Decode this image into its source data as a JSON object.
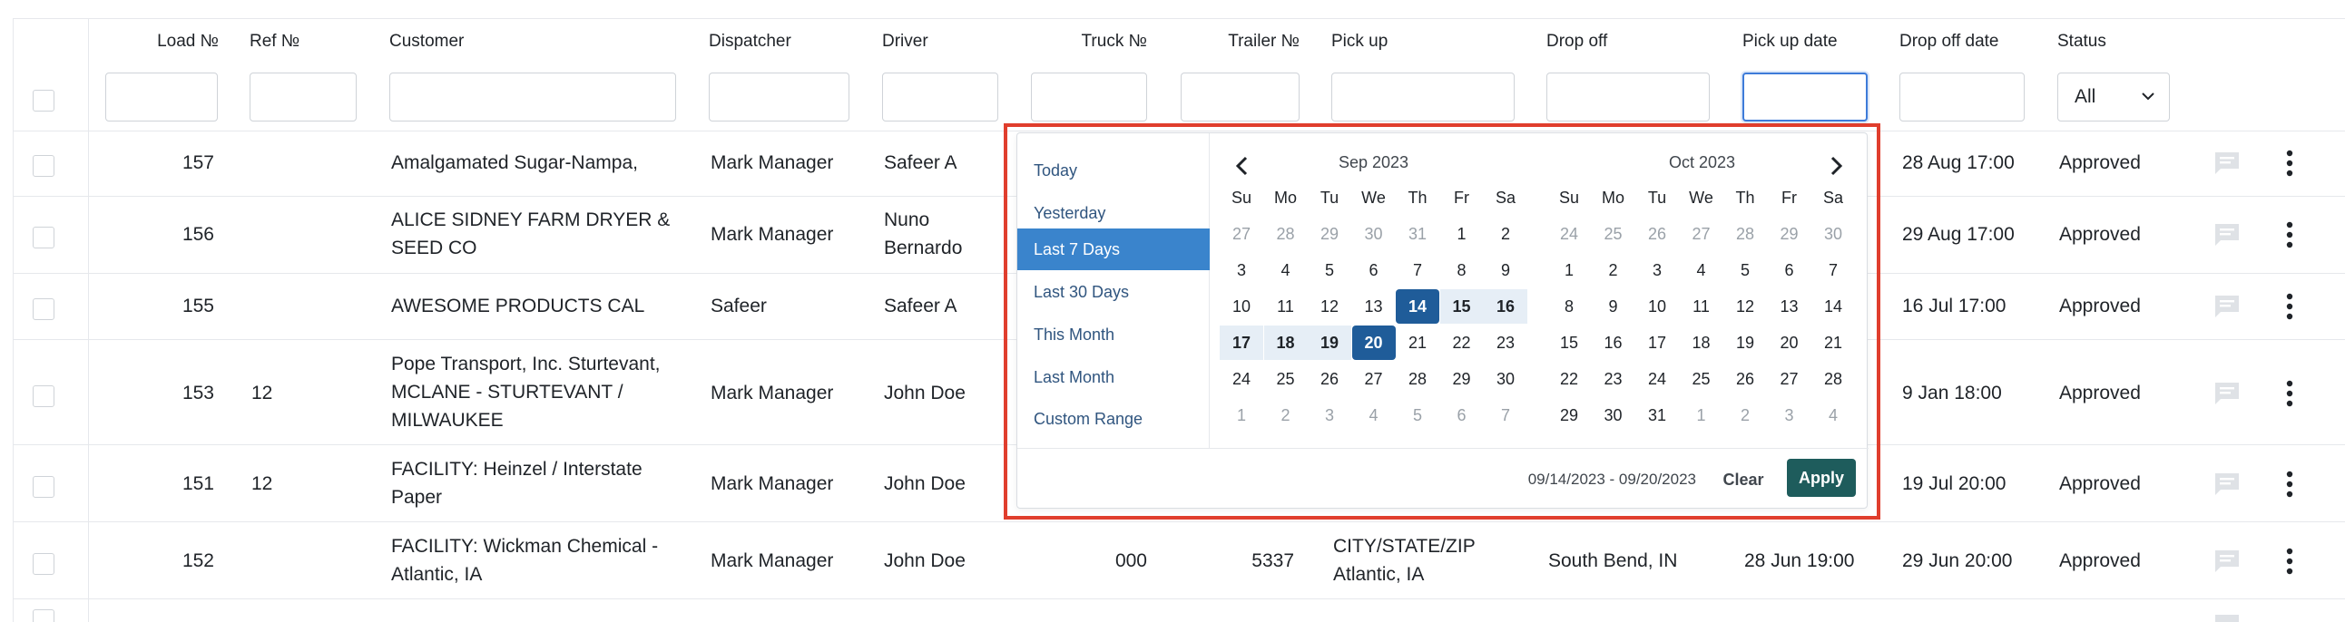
{
  "columns": {
    "load_no": "Load №",
    "ref_no": "Ref №",
    "customer": "Customer",
    "dispatcher": "Dispatcher",
    "driver": "Driver",
    "truck_no": "Truck №",
    "trailer_no": "Trailer №",
    "pick_up": "Pick up",
    "drop_off": "Drop off",
    "pick_up_date": "Pick up date",
    "drop_off_date": "Drop off date",
    "status": "Status"
  },
  "filters": {
    "status_selected": "All"
  },
  "rows": [
    {
      "load_no": "157",
      "ref_no": "",
      "customer": [
        "Amalgamated Sugar-Nampa,"
      ],
      "dispatcher": "Mark Manager",
      "driver": [
        "Safeer A"
      ],
      "truck_no": "",
      "trailer_no": "",
      "pick_up": [],
      "drop_off": "",
      "pick_up_date": "",
      "drop_off_date": "28 Aug 17:00",
      "status": "Approved"
    },
    {
      "load_no": "156",
      "ref_no": "",
      "customer": [
        "ALICE SIDNEY FARM DRYER &",
        "SEED CO"
      ],
      "dispatcher": "Mark Manager",
      "driver": [
        "Nuno",
        "Bernardo"
      ],
      "truck_no": "",
      "trailer_no": "",
      "pick_up": [],
      "drop_off": "",
      "pick_up_date": "",
      "drop_off_date": "29 Aug 17:00",
      "status": "Approved"
    },
    {
      "load_no": "155",
      "ref_no": "",
      "customer": [
        "AWESOME PRODUCTS CAL"
      ],
      "dispatcher": "Safeer",
      "driver": [
        "Safeer A"
      ],
      "truck_no": "",
      "trailer_no": "",
      "pick_up": [],
      "drop_off": "",
      "pick_up_date": "",
      "drop_off_date": "16 Jul 17:00",
      "status": "Approved"
    },
    {
      "load_no": "153",
      "ref_no": "12",
      "customer": [
        "Pope Transport, Inc. Sturtevant,",
        "MCLANE - STURTEVANT /",
        "MILWAUKEE"
      ],
      "dispatcher": "Mark Manager",
      "driver": [
        "John Doe"
      ],
      "truck_no": "",
      "trailer_no": "",
      "pick_up": [],
      "drop_off": "",
      "pick_up_date": "",
      "drop_off_date": "9 Jan 18:00",
      "status": "Approved"
    },
    {
      "load_no": "151",
      "ref_no": "12",
      "customer": [
        "FACILITY: Heinzel / Interstate",
        "Paper"
      ],
      "dispatcher": "Mark Manager",
      "driver": [
        "John Doe"
      ],
      "truck_no": "",
      "trailer_no": "",
      "pick_up": [],
      "drop_off": "",
      "pick_up_date": "",
      "drop_off_date": "19 Jul 20:00",
      "status": "Approved"
    },
    {
      "load_no": "152",
      "ref_no": "",
      "customer": [
        "FACILITY: Wickman Chemical -",
        "Atlantic, IA"
      ],
      "dispatcher": "Mark Manager",
      "driver": [
        "John Doe"
      ],
      "truck_no": "000",
      "trailer_no": "5337",
      "pick_up": [
        "CITY/STATE/ZIP",
        "Atlantic, IA"
      ],
      "drop_off": "South Bend, IN",
      "pick_up_date": "28 Jun 19:00",
      "drop_off_date": "29 Jun 20:00",
      "status": "Approved"
    }
  ],
  "date_picker": {
    "ranges": [
      "Today",
      "Yesterday",
      "Last 7 Days",
      "Last 30 Days",
      "This Month",
      "Last Month",
      "Custom Range"
    ],
    "active_range": "Last 7 Days",
    "weekdays": [
      "Su",
      "Mo",
      "Tu",
      "We",
      "Th",
      "Fr",
      "Sa"
    ],
    "left_month": {
      "title": "Sep 2023",
      "weeks": [
        [
          "27",
          "28",
          "29",
          "30",
          "31",
          "1",
          "2"
        ],
        [
          "3",
          "4",
          "5",
          "6",
          "7",
          "8",
          "9"
        ],
        [
          "10",
          "11",
          "12",
          "13",
          "14",
          "15",
          "16"
        ],
        [
          "17",
          "18",
          "19",
          "20",
          "21",
          "22",
          "23"
        ],
        [
          "24",
          "25",
          "26",
          "27",
          "28",
          "29",
          "30"
        ],
        [
          "1",
          "2",
          "3",
          "4",
          "5",
          "6",
          "7"
        ]
      ]
    },
    "right_month": {
      "title": "Oct 2023",
      "weeks": [
        [
          "24",
          "25",
          "26",
          "27",
          "28",
          "29",
          "30"
        ],
        [
          "1",
          "2",
          "3",
          "4",
          "5",
          "6",
          "7"
        ],
        [
          "8",
          "9",
          "10",
          "11",
          "12",
          "13",
          "14"
        ],
        [
          "15",
          "16",
          "17",
          "18",
          "19",
          "20",
          "21"
        ],
        [
          "22",
          "23",
          "24",
          "25",
          "26",
          "27",
          "28"
        ],
        [
          "29",
          "30",
          "31",
          "1",
          "2",
          "3",
          "4"
        ]
      ]
    },
    "range_text": "09/14/2023 - 09/20/2023",
    "clear_label": "Clear",
    "apply_label": "Apply",
    "accent_color": "#3a84cc",
    "selected_color": "#1f5c99",
    "apply_color": "#1e5c5c",
    "highlight_color": "#e03e2d"
  }
}
